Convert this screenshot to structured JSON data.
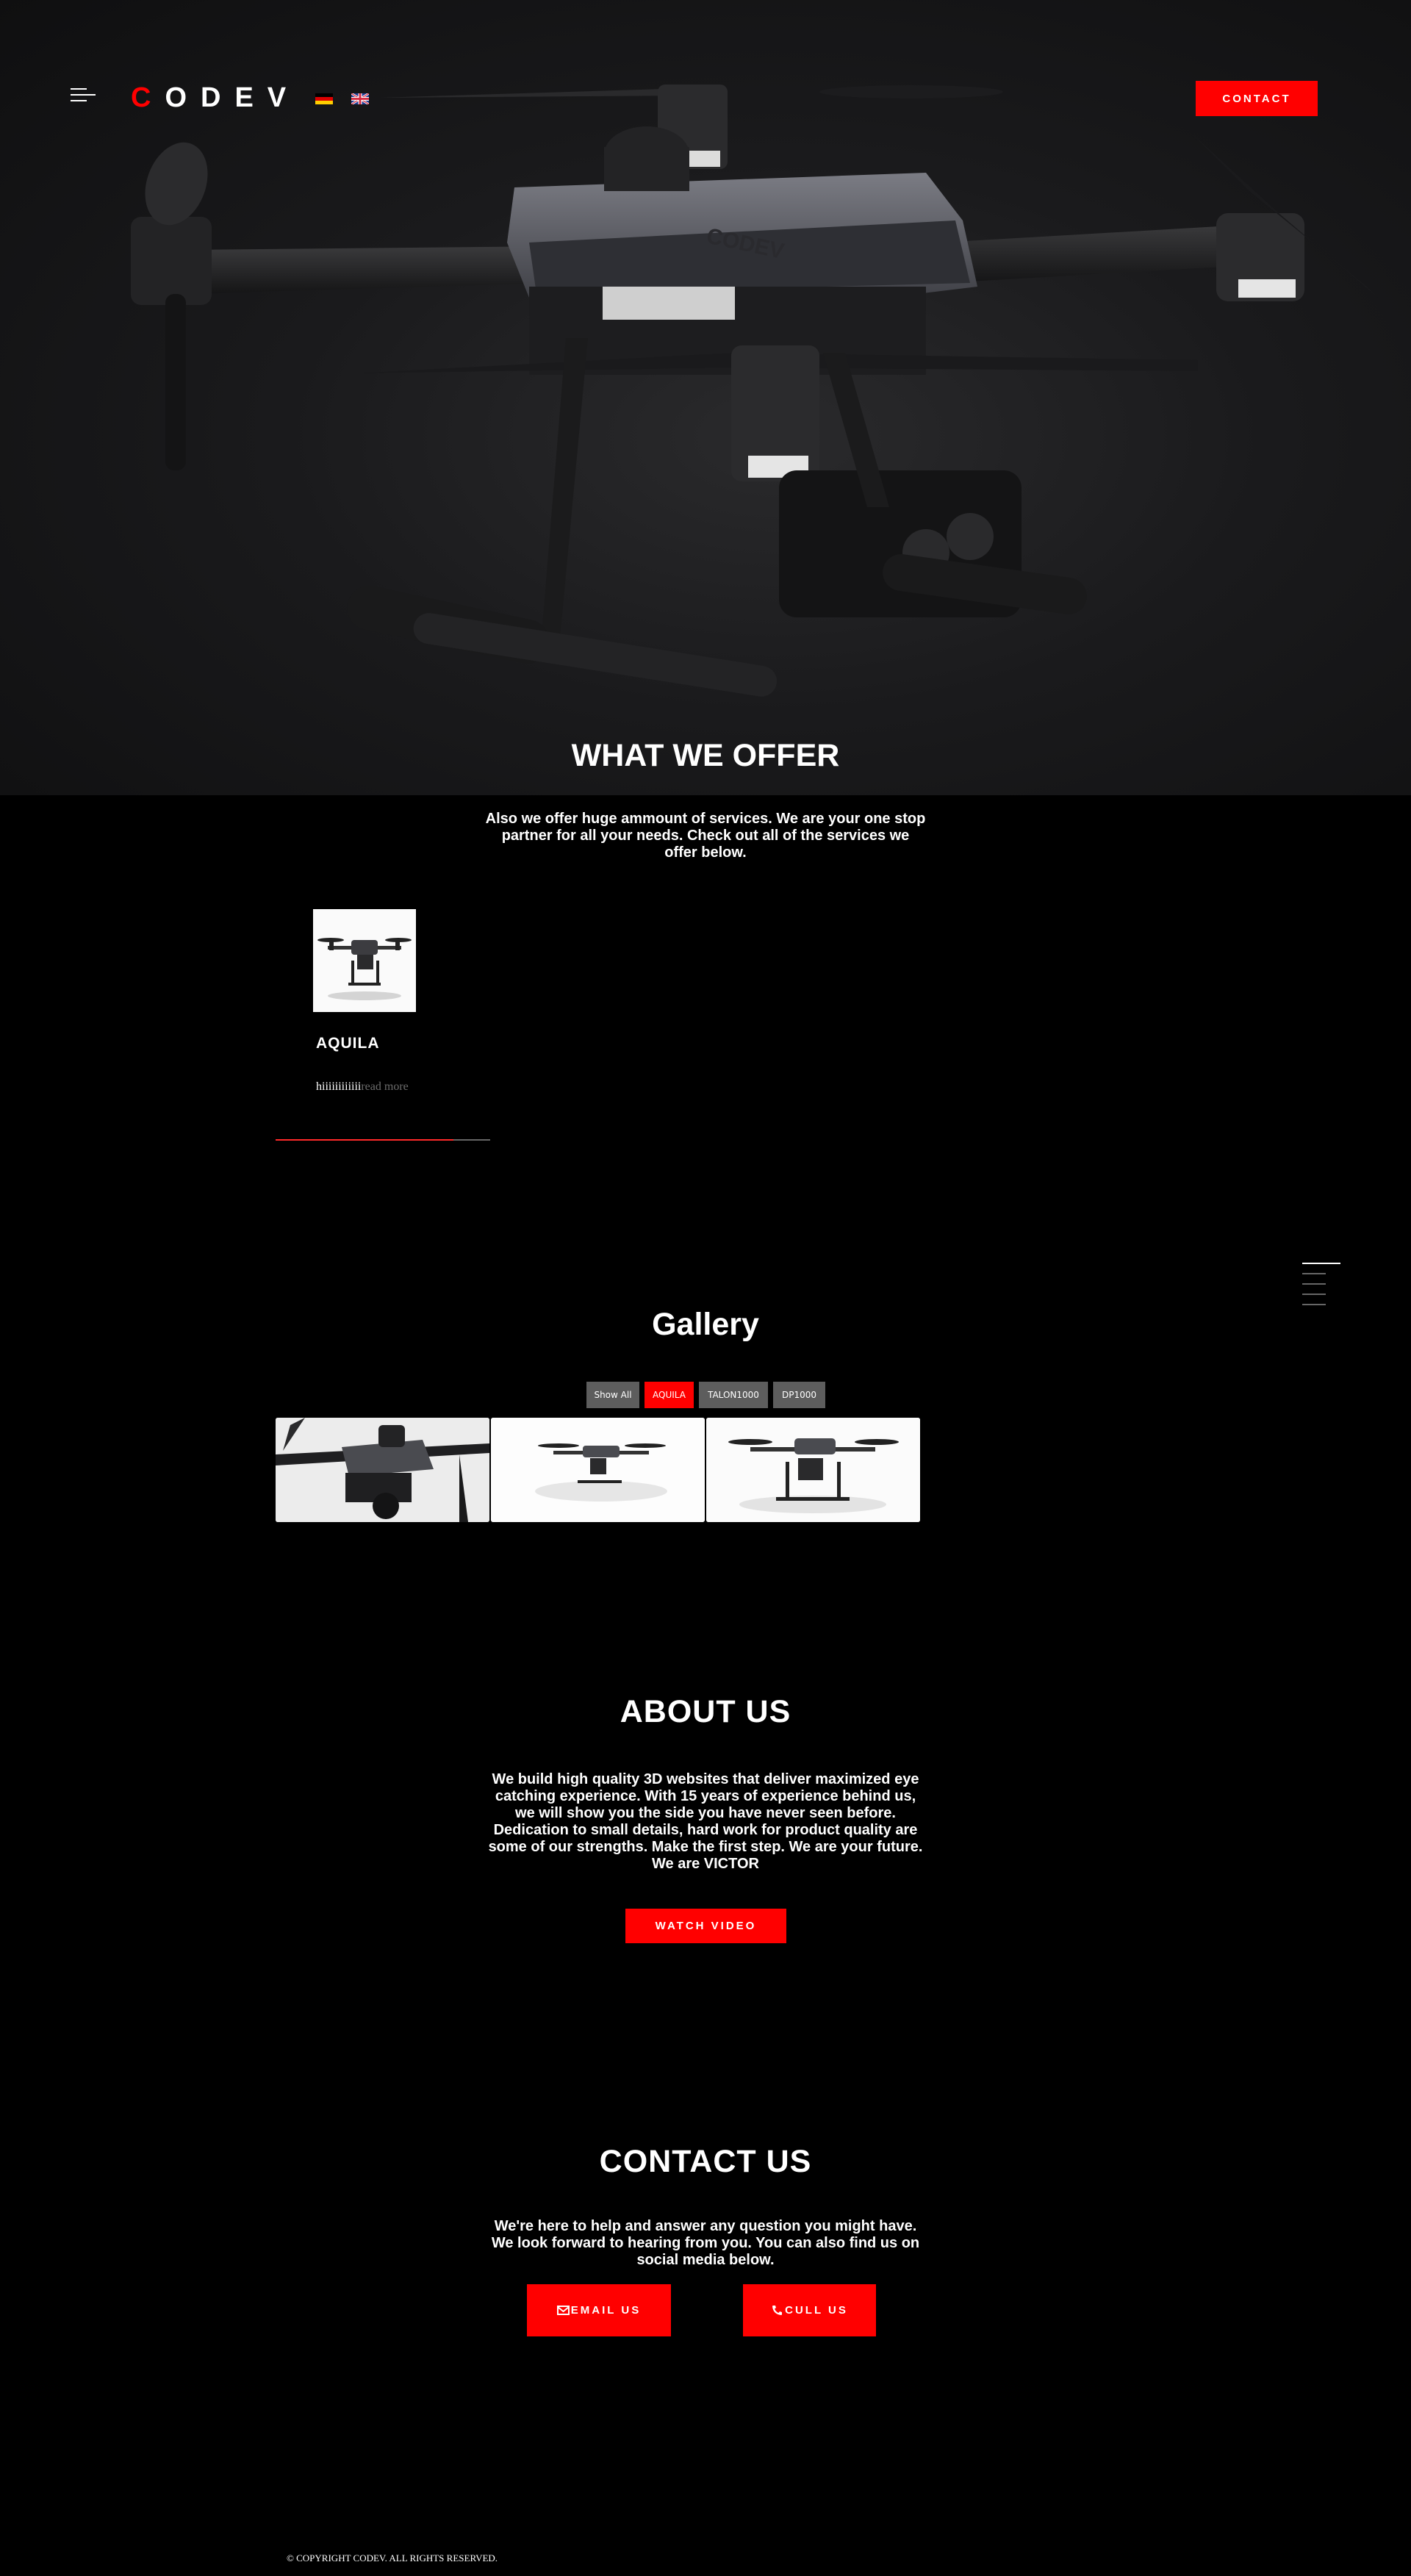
{
  "header": {
    "logo_first": "C",
    "logo_rest": "ODEV",
    "contact_label": "CONTACT",
    "languages": [
      "de-flag-icon",
      "en-flag-icon"
    ]
  },
  "offer": {
    "title": "WHAT WE OFFER",
    "text": "Also we offer huge ammount of services. We are your one stop partner for all your needs. Check out all of the services we offer below."
  },
  "product": {
    "title": "AQUILA",
    "desc": "hiiiiiiiiiiii",
    "more": "read more"
  },
  "gallery": {
    "title": "Gallery",
    "filters": [
      "Show All",
      "AQUILA",
      "TALON1000",
      "DP1000"
    ],
    "active_filter": "AQUILA"
  },
  "about": {
    "title": "ABOUT US",
    "text": "We build high quality 3D websites that deliver maximized eye catching experience. With 15 years of experience behind us, we will show you the side you have never seen before. Dedication to small details, hard work for product quality are some of our strengths. Make the first step. We are your future. We are VICTOR",
    "button": "WATCH VIDEO"
  },
  "contact": {
    "title": "CONTACT US",
    "text": "We're here to help and answer any question you might have. We look forward to hearing from you. You can also find us on social media below.",
    "email_label": "EMAIL US",
    "call_label": "CULL US"
  },
  "footer": {
    "text": "© COPYRIGHT CODEV. ALL RIGHTS RESERVED."
  },
  "colors": {
    "accent": "#ff0000",
    "background": "#000000",
    "filter_inactive": "#5d5d5d"
  }
}
